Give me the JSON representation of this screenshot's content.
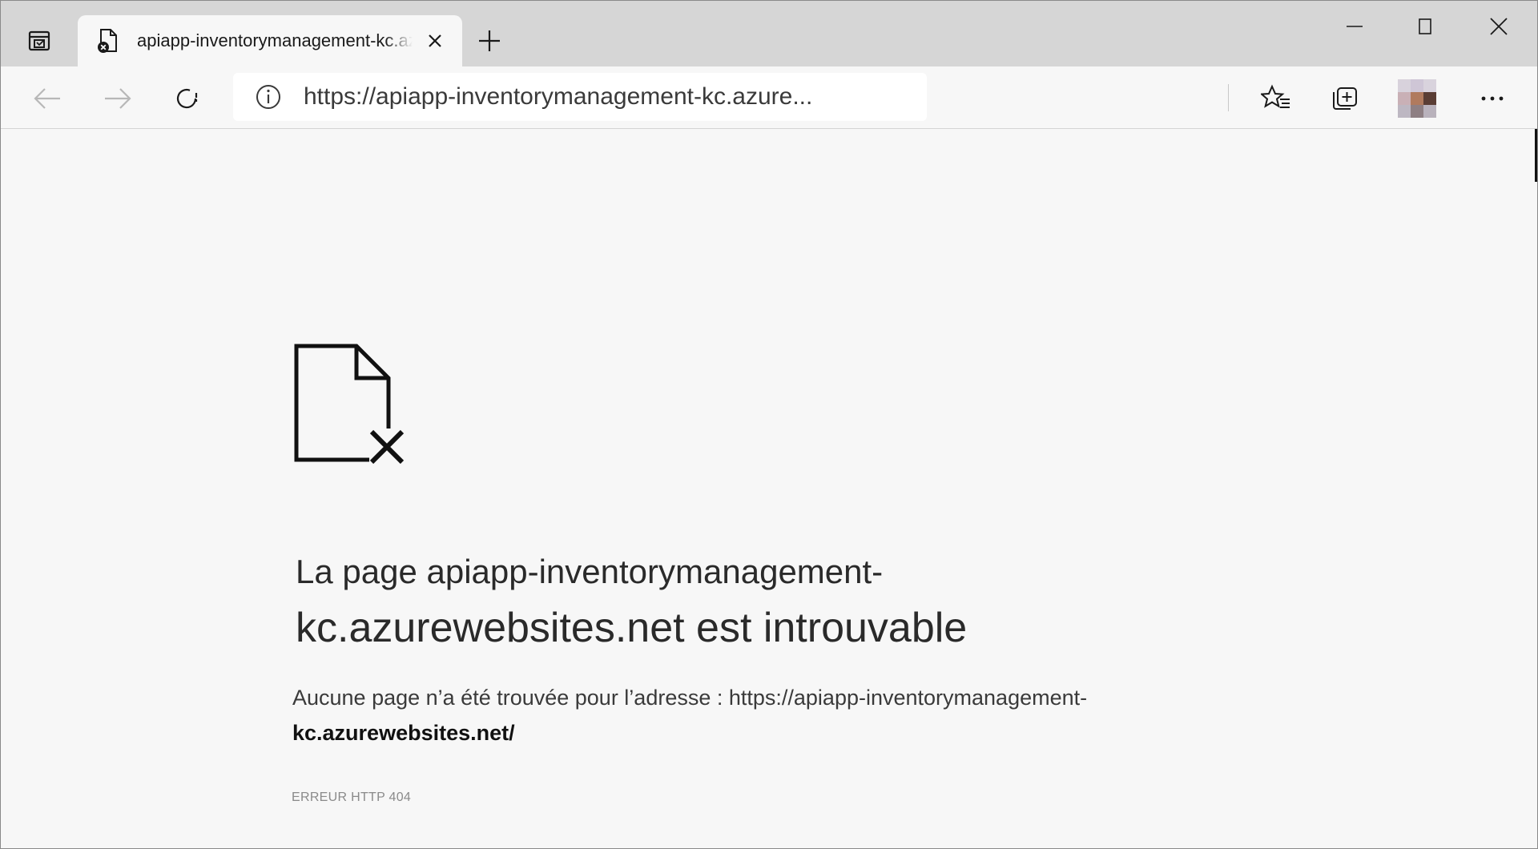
{
  "browser": {
    "tab": {
      "title": "apiapp-inventorymanagement-kc.azurewebsites.net"
    },
    "address_bar": {
      "url": "https://apiapp-inventorymanagement-kc.azure..."
    },
    "icons": {
      "tab_actions": "tab-actions-icon",
      "favicon": "page-error-icon",
      "close_tab": "close-icon",
      "new_tab": "plus-icon",
      "minimize": "minimize-icon",
      "maximize": "maximize-icon",
      "close_window": "close-icon",
      "back": "arrow-left-icon",
      "forward": "arrow-right-icon",
      "refresh": "refresh-icon",
      "site_info": "info-icon",
      "favorites": "favorites-icon",
      "collections": "collections-icon",
      "profile": "avatar",
      "more": "ellipsis-icon"
    }
  },
  "error_page": {
    "title_line1": "La page apiapp-inventorymanagement-",
    "title_line2": "kc.azurewebsites.net est introuvable",
    "description_prefix": "Aucune page n’a été trouvée pour l’adresse : https://apiapp-inventorymanagement-",
    "description_url": "kc.azurewebsites.net/",
    "error_code": "ERREUR HTTP 404",
    "icon": "file-not-found-icon"
  },
  "colors": {
    "tabstrip": "#d6d6d6",
    "page_background": "#f7f7f7",
    "text": "#2a2a2a",
    "muted": "#8a8a8a"
  }
}
